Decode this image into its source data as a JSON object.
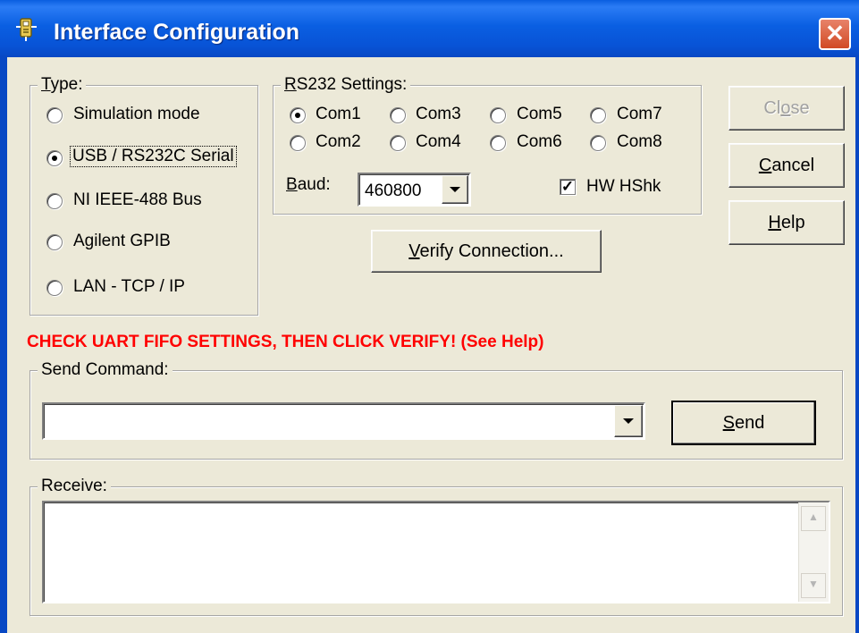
{
  "window": {
    "title": "Interface Configuration",
    "close_glyph": "✕",
    "title_icon": "device-icon"
  },
  "type_group": {
    "legend": "Type:",
    "options": [
      {
        "label": "Simulation mode",
        "checked": false
      },
      {
        "label": "USB / RS232C Serial",
        "checked": true
      },
      {
        "label": "NI IEEE-488 Bus",
        "checked": false
      },
      {
        "label": "Agilent GPIB",
        "checked": false
      },
      {
        "label": "LAN - TCP / IP",
        "checked": false
      }
    ]
  },
  "rs232": {
    "legend": "RS232 Settings:",
    "ports": [
      {
        "label": "Com1",
        "checked": true
      },
      {
        "label": "Com3",
        "checked": false
      },
      {
        "label": "Com5",
        "checked": false
      },
      {
        "label": "Com7",
        "checked": false
      },
      {
        "label": "Com2",
        "checked": false
      },
      {
        "label": "Com4",
        "checked": false
      },
      {
        "label": "Com6",
        "checked": false
      },
      {
        "label": "Com8",
        "checked": false
      }
    ],
    "baud_label": "Baud:",
    "baud_value": "460800",
    "hwhshk_label": "HW HShk",
    "hwhshk_checked": true,
    "check_glyph": "✓"
  },
  "buttons": {
    "close": "Close",
    "cancel": "Cancel",
    "help": "Help",
    "verify": "Verify Connection...",
    "send": "Send"
  },
  "warning": "CHECK UART FIFO SETTINGS, THEN CLICK VERIFY! (See Help)",
  "send_group": {
    "legend": "Send Command:",
    "value": ""
  },
  "receive_group": {
    "legend": "Receive:",
    "value": ""
  },
  "scrollbar": {
    "up_glyph": "▲",
    "down_glyph": "▼"
  },
  "colors": {
    "titlebar": "#0a5fe2",
    "dialog_bg": "#ece9d8",
    "warning": "#ff0000",
    "close_button": "#d14a24"
  }
}
